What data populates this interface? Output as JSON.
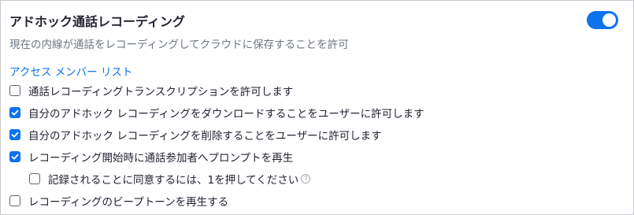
{
  "setting": {
    "title": "アドホック通話レコーディング",
    "description": "現在の内線が通話をレコーディングしてクラウドに保存することを許可",
    "toggle_on": true,
    "access_link": "アクセス メンバー リスト"
  },
  "options": [
    {
      "label": "通話レコーディングトランスクリプションを許可します",
      "checked": false
    },
    {
      "label": "自分のアドホック レコーディングをダウンロードすることをユーザーに許可します",
      "checked": true
    },
    {
      "label": "自分のアドホック レコーディングを削除することをユーザーに許可します",
      "checked": true
    },
    {
      "label": "レコーディング開始時に通話参加者へプロンプトを再生",
      "checked": true
    },
    {
      "label": "記録されることに同意するには、1を押してください",
      "checked": false,
      "help_icon": "question-circle-icon"
    },
    {
      "label": "レコーディングのビープトーンを再生する",
      "checked": false
    }
  ],
  "colors": {
    "accent": "#0e72ed",
    "text": "#232333",
    "muted": "#6e7680"
  }
}
